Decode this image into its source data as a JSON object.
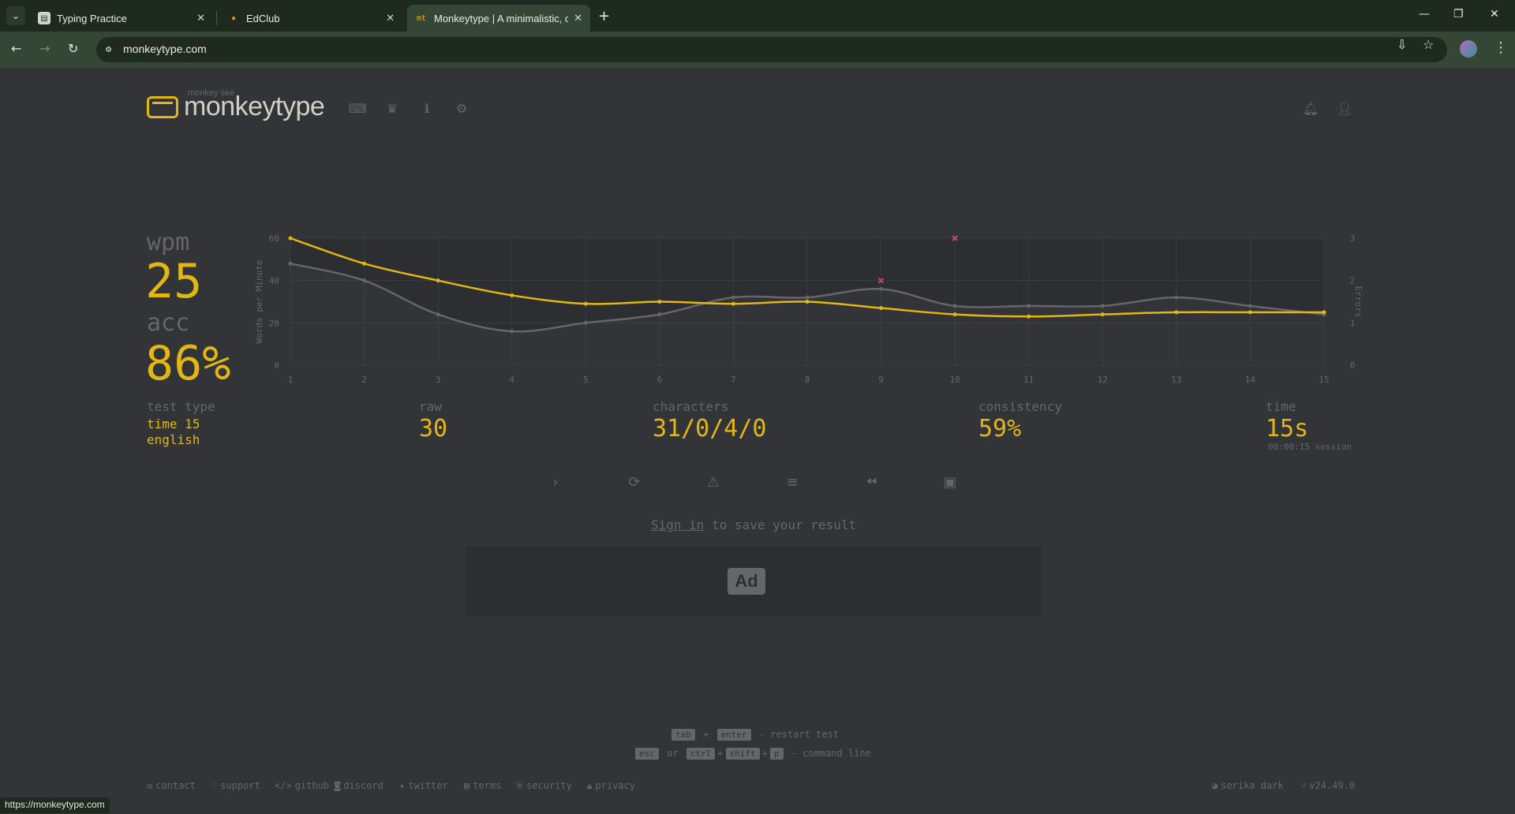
{
  "browser": {
    "tabs": [
      {
        "title": "Typing Practice",
        "favicon": "document-icon"
      },
      {
        "title": "EdClub",
        "favicon": "flame-icon"
      },
      {
        "title": "Monkeytype | A minimalistic, cu",
        "favicon": "mt-icon"
      }
    ],
    "url": "monkeytype.com",
    "status_url": "https://monkeytype.com"
  },
  "header": {
    "logo_small": "monkey see",
    "logo_text": "monkeytype"
  },
  "stats": {
    "wpm_label": "wpm",
    "wpm_value": "25",
    "acc_label": "acc",
    "acc_value": "86%",
    "test_type_label": "test type",
    "test_type_value_1": "time 15",
    "test_type_value_2": "english",
    "raw_label": "raw",
    "raw_value": "30",
    "characters_label": "characters",
    "characters_value": "31/0/4/0",
    "consistency_label": "consistency",
    "consistency_value": "59%",
    "time_label": "time",
    "time_value": "15s",
    "session_text": "00:00:15 session"
  },
  "result": {
    "signin_link": "Sign in",
    "signin_rest": " to save your result",
    "ad_label": "Ad"
  },
  "hints": {
    "line1_keys": [
      "tab",
      "enter"
    ],
    "line1_text": "- restart test",
    "line2_keys": [
      "esc",
      "ctrl",
      "shift",
      "p"
    ],
    "line2_or": "or",
    "line2_text": "- command line"
  },
  "footer": {
    "links": [
      "contact",
      "support",
      "github",
      "discord",
      "twitter",
      "terms",
      "security",
      "privacy"
    ],
    "theme": "serika dark",
    "version": "v24.49.0"
  },
  "colors": {
    "accent": "#e2b714",
    "sub": "#646669",
    "text": "#d1d0c5",
    "bg": "#323437",
    "error": "#ca4754"
  },
  "chart_data": {
    "type": "line",
    "x": [
      1,
      2,
      3,
      4,
      5,
      6,
      7,
      8,
      9,
      10,
      11,
      12,
      13,
      14,
      15
    ],
    "series": [
      {
        "name": "wpm",
        "values": [
          60,
          48,
          40,
          33,
          29,
          30,
          29,
          30,
          27,
          24,
          23,
          24,
          25,
          25,
          25
        ]
      },
      {
        "name": "raw",
        "values": [
          48,
          40,
          24,
          16,
          20,
          24,
          32,
          32,
          36,
          28,
          28,
          28,
          32,
          28,
          24
        ]
      },
      {
        "name": "errors",
        "values": [
          0,
          0,
          0,
          0,
          0,
          0,
          0,
          0,
          2,
          3,
          0,
          0,
          0,
          0,
          0
        ]
      }
    ],
    "ylabel": "Words per Minute",
    "y2label": "Errors",
    "ylim": [
      0,
      60
    ],
    "y2lim": [
      0,
      3
    ],
    "yticks": [
      "0",
      "20",
      "40",
      "60"
    ],
    "y2ticks": [
      "0",
      "1",
      "2",
      "3"
    ],
    "grid": true
  }
}
